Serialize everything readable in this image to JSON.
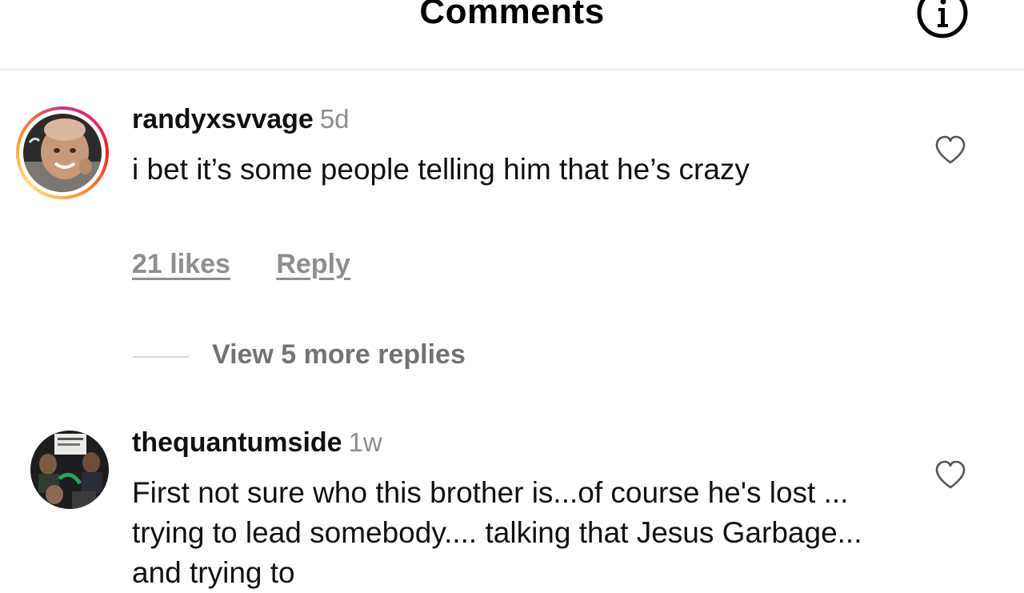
{
  "header": {
    "title": "Comments",
    "info_icon": "info-circle-icon"
  },
  "comments": [
    {
      "username": "randyxsvvage",
      "time": "5d",
      "text": "i bet it’s some people telling him that he’s crazy",
      "likes_label": "21 likes",
      "reply_label": "Reply",
      "has_story_ring": true,
      "like_icon": "heart-outline-icon",
      "view_replies_label": "View 5 more replies"
    },
    {
      "username": "thequantumside",
      "time": "1w",
      "text": "First not sure who this brother is...of course he's lost ... trying to lead somebody.... talking that Jesus Garbage... and trying to",
      "has_story_ring": false,
      "like_icon": "heart-outline-icon"
    }
  ],
  "colors": {
    "username": "#111111",
    "muted": "#8e8e8e",
    "view_replies": "#737373",
    "divider": "#ececec",
    "story_ring_start": "#c13584",
    "story_ring_end": "#fcaf45"
  }
}
